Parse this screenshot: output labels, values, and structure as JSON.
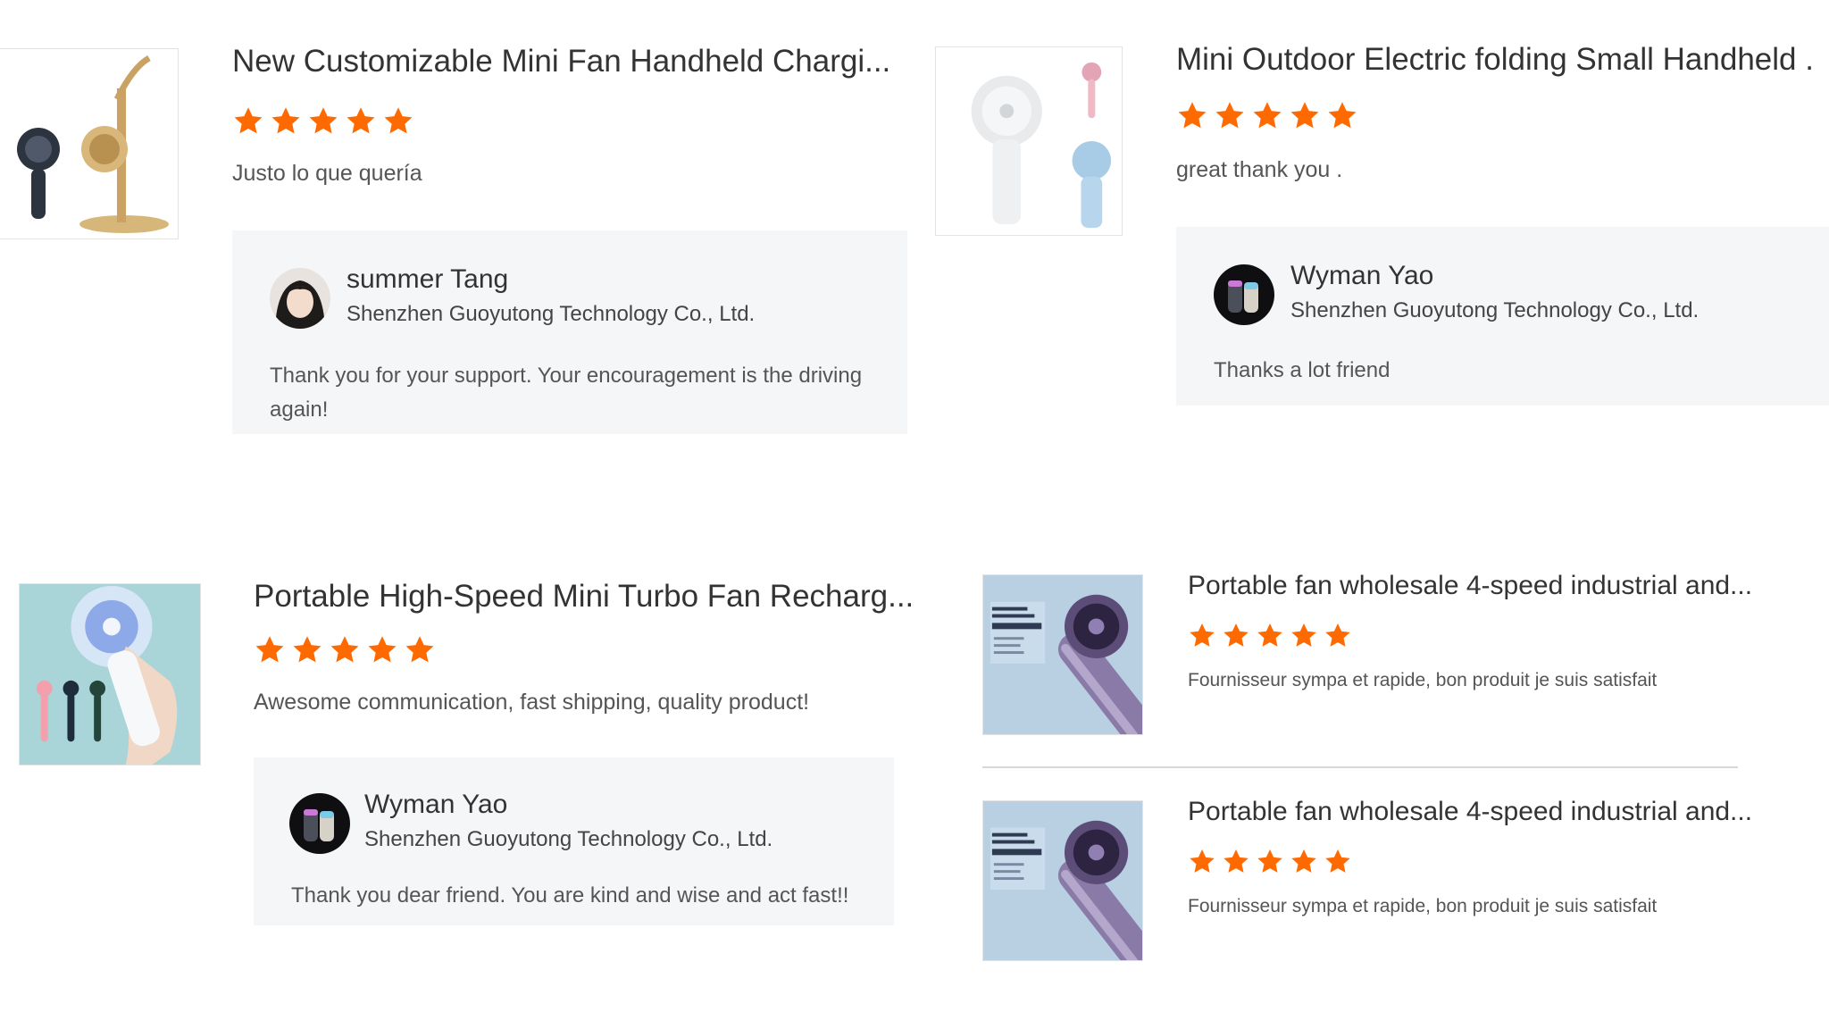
{
  "colors": {
    "star": "#ff6a00",
    "reply_bg": "#f5f6f8"
  },
  "reviews": [
    {
      "product_title": "New Customizable Mini Fan Handheld Chargi...",
      "rating": 5,
      "comment": "Justo lo que quería",
      "reply": {
        "name": "summer Tang",
        "company": "Shenzhen Guoyutong Technology Co., Ltd.",
        "text": "Thank you for your support. Your encouragement is the driving again!"
      }
    },
    {
      "product_title": "Mini Outdoor Electric folding Small Handheld ...",
      "rating": 5,
      "comment": "great  thank you .",
      "reply": {
        "name": "Wyman Yao",
        "company": "Shenzhen Guoyutong Technology Co., Ltd.",
        "text": "Thanks a lot friend"
      }
    },
    {
      "product_title": "Portable High-Speed Mini Turbo Fan Recharg...",
      "rating": 5,
      "comment": "Awesome communication,  fast shipping,  quality product!",
      "reply": {
        "name": "Wyman Yao",
        "company": "Shenzhen Guoyutong Technology Co., Ltd.",
        "text": "Thank you dear friend. You are kind and wise and act fast!!"
      }
    },
    {
      "product_title": "Portable fan wholesale 4-speed industrial and...",
      "rating": 5,
      "comment": "Fournisseur sympa et rapide, bon produit je suis satisfait"
    },
    {
      "product_title": "Portable fan wholesale 4-speed industrial and...",
      "rating": 5,
      "comment": "Fournisseur sympa et rapide, bon produit je suis satisfait"
    }
  ]
}
